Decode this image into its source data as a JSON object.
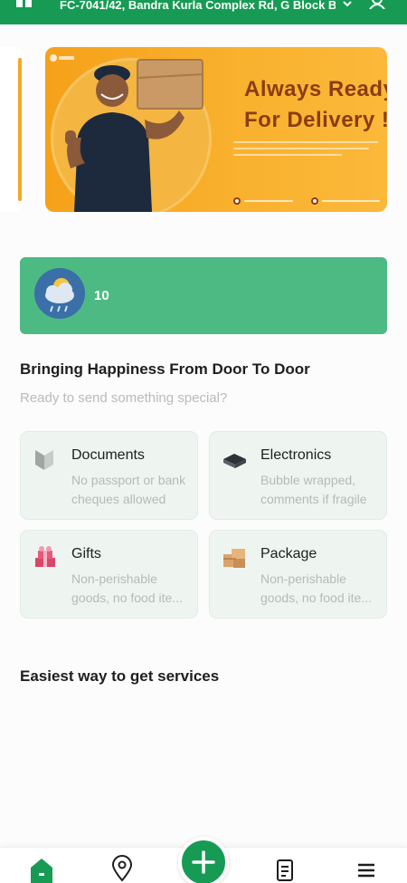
{
  "header": {
    "address": "FC-7041/42, Bandra Kurla Complex Rd, G Block BK..."
  },
  "banner": {
    "title_line1": "Always Ready",
    "title_line2": "For Delivery !"
  },
  "weather": {
    "temperature": "10"
  },
  "section": {
    "title": "Bringing Happiness From Door To Door",
    "subtitle": "Ready to send something special?"
  },
  "services": [
    {
      "title": "Documents",
      "desc": "No passport or bank cheques allowed"
    },
    {
      "title": "Electronics",
      "desc": "Bubble wrapped, comments if fragile"
    },
    {
      "title": "Gifts",
      "desc": "Non-perishable goods, no food ite..."
    },
    {
      "title": "Package",
      "desc": "Non-perishable goods, no food ite..."
    }
  ],
  "section2": {
    "title": "Easiest way to get services"
  },
  "colors": {
    "primary": "#179b54",
    "weather_card": "#4dba84",
    "banner": "#f9b22f"
  },
  "icons": {
    "header": [
      "app-logo-icon",
      "chevron-down-icon",
      "user-icon"
    ],
    "nav": [
      "home-icon",
      "location-pin-icon",
      "add-icon",
      "orders-icon",
      "menu-icon"
    ]
  }
}
